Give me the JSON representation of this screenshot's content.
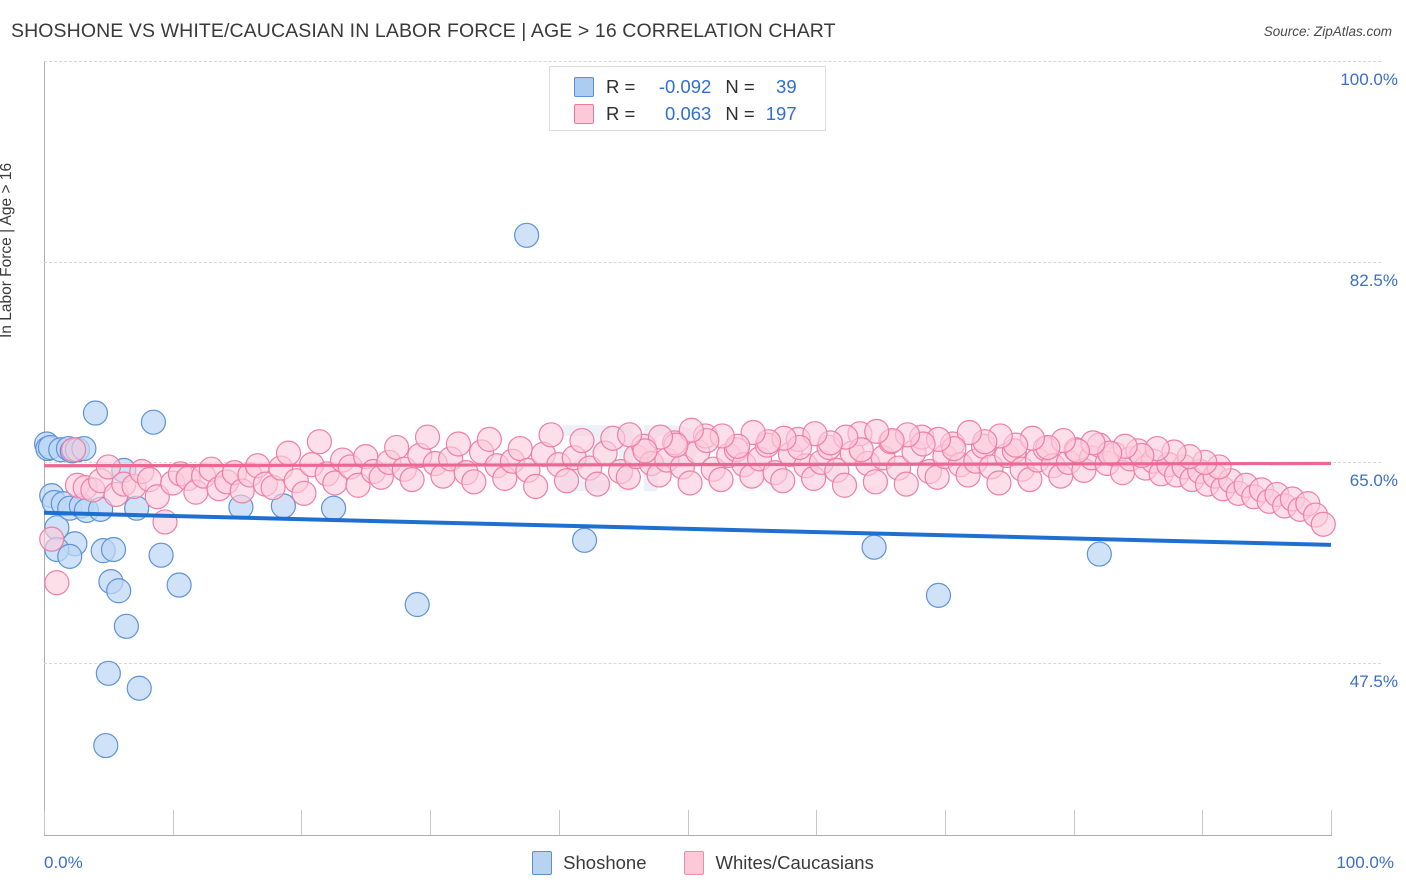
{
  "header": {
    "title": "SHOSHONE VS WHITE/CAUCASIAN IN LABOR FORCE | AGE > 16 CORRELATION CHART",
    "source": "Source: ZipAtlas.com"
  },
  "watermark": {
    "bold": "ZIP",
    "light": "atlas"
  },
  "axes": {
    "y_title": "In Labor Force | Age > 16",
    "y_ticks": [
      {
        "label": "100.0%",
        "value": 100.0
      },
      {
        "label": "82.5%",
        "value": 82.5
      },
      {
        "label": "65.0%",
        "value": 65.0
      },
      {
        "label": "47.5%",
        "value": 47.5
      }
    ],
    "x_min_label": "0.0%",
    "x_max_label": "100.0%"
  },
  "stats": {
    "rows": [
      {
        "swatch": "blue",
        "r_label": "R =",
        "r_value": "-0.092",
        "n_label": "N =",
        "n_value": "39"
      },
      {
        "swatch": "pink",
        "r_label": "R =",
        "r_value": "0.063",
        "n_label": "N =",
        "n_value": "197"
      }
    ]
  },
  "legend": {
    "items": [
      {
        "label": "Shoshone",
        "color": "#b8d3f2"
      },
      {
        "label": "Whites/Caucasians",
        "color": "#fcc9d9"
      }
    ]
  },
  "colors": {
    "blue_fill": "#bdd7f5",
    "blue_stroke": "#5f93d6",
    "pink_fill": "#fcccdc",
    "pink_stroke": "#ef7fa6",
    "blue_trend": "#1f6fd0",
    "pink_trend": "#ec6893",
    "label_blue": "#3b6fc4",
    "grid": "#d8d8d8"
  },
  "chart_data": {
    "type": "scatter",
    "title": "SHOSHONE VS WHITE/CAUCASIAN IN LABOR FORCE | AGE > 16 CORRELATION CHART",
    "xlabel": "",
    "ylabel": "In Labor Force | Age > 16",
    "xlim": [
      0,
      100
    ],
    "ylim": [
      32.5,
      100
    ],
    "grid": true,
    "legend_position": "bottom-center",
    "yticks": [
      47.5,
      65.0,
      82.5,
      100.0
    ],
    "series": [
      {
        "name": "Shoshone",
        "r": -0.092,
        "n": 39,
        "color": "#bdd7f5",
        "trend": {
          "x0": 0,
          "y0": 60.6,
          "x1": 100,
          "y1": 57.8
        },
        "points": [
          [
            0.2,
            66.6
          ],
          [
            0.3,
            66.2
          ],
          [
            0.5,
            66.3
          ],
          [
            0.6,
            62.1
          ],
          [
            0.8,
            61.5
          ],
          [
            1.3,
            66.1
          ],
          [
            1.9,
            66.2
          ],
          [
            2.2,
            66.0
          ],
          [
            2.6,
            66.1
          ],
          [
            3.1,
            66.2
          ],
          [
            4.0,
            69.3
          ],
          [
            1.0,
            59.3
          ],
          [
            1.5,
            61.4
          ],
          [
            2.0,
            61.0
          ],
          [
            2.9,
            61.2
          ],
          [
            3.3,
            60.8
          ],
          [
            4.4,
            60.9
          ],
          [
            2.4,
            57.9
          ],
          [
            1.0,
            57.4
          ],
          [
            2.0,
            56.8
          ],
          [
            4.6,
            57.3
          ],
          [
            5.4,
            57.4
          ],
          [
            6.2,
            64.3
          ],
          [
            7.2,
            61.0
          ],
          [
            8.5,
            68.5
          ],
          [
            9.1,
            56.9
          ],
          [
            10.5,
            54.3
          ],
          [
            5.2,
            54.6
          ],
          [
            5.8,
            53.8
          ],
          [
            6.4,
            50.7
          ],
          [
            5.0,
            46.6
          ],
          [
            7.4,
            45.3
          ],
          [
            4.8,
            40.3
          ],
          [
            15.3,
            61.1
          ],
          [
            18.6,
            61.2
          ],
          [
            22.5,
            61.0
          ],
          [
            29.0,
            52.6
          ],
          [
            37.5,
            84.8
          ],
          [
            42.0,
            58.2
          ],
          [
            64.5,
            57.6
          ],
          [
            69.5,
            53.4
          ],
          [
            82.0,
            57.0
          ]
        ]
      },
      {
        "name": "Whites/Caucasians",
        "r": 0.063,
        "n": 197,
        "color": "#fcccdc",
        "trend": {
          "x0": 0,
          "y0": 64.7,
          "x1": 100,
          "y1": 64.9
        },
        "points": [
          [
            0.6,
            58.3
          ],
          [
            1.0,
            54.5
          ],
          [
            2.3,
            66.1
          ],
          [
            2.6,
            63.0
          ],
          [
            3.2,
            62.8
          ],
          [
            3.8,
            62.6
          ],
          [
            4.4,
            63.4
          ],
          [
            5.0,
            64.6
          ],
          [
            5.6,
            62.2
          ],
          [
            6.2,
            63.1
          ],
          [
            7.0,
            62.9
          ],
          [
            7.6,
            64.2
          ],
          [
            8.2,
            63.5
          ],
          [
            8.8,
            62.0
          ],
          [
            9.4,
            59.8
          ],
          [
            10.0,
            63.2
          ],
          [
            10.6,
            64.0
          ],
          [
            11.2,
            63.6
          ],
          [
            11.8,
            62.4
          ],
          [
            12.4,
            63.8
          ],
          [
            13.0,
            64.4
          ],
          [
            13.6,
            62.7
          ],
          [
            14.2,
            63.3
          ],
          [
            14.8,
            64.1
          ],
          [
            15.4,
            62.5
          ],
          [
            16.0,
            63.9
          ],
          [
            16.6,
            64.7
          ],
          [
            17.2,
            63.1
          ],
          [
            17.8,
            62.8
          ],
          [
            18.4,
            64.5
          ],
          [
            19.0,
            65.8
          ],
          [
            19.6,
            63.4
          ],
          [
            20.2,
            62.3
          ],
          [
            20.8,
            64.8
          ],
          [
            21.4,
            66.8
          ],
          [
            22.0,
            64.0
          ],
          [
            22.6,
            63.2
          ],
          [
            23.2,
            65.2
          ],
          [
            23.8,
            64.6
          ],
          [
            24.4,
            63.0
          ],
          [
            25.0,
            65.5
          ],
          [
            25.6,
            64.2
          ],
          [
            26.2,
            63.7
          ],
          [
            26.8,
            65.0
          ],
          [
            27.4,
            66.3
          ],
          [
            28.0,
            64.4
          ],
          [
            28.6,
            63.5
          ],
          [
            29.2,
            65.6
          ],
          [
            29.8,
            67.2
          ],
          [
            30.4,
            64.9
          ],
          [
            31.0,
            63.8
          ],
          [
            31.6,
            65.3
          ],
          [
            32.2,
            66.6
          ],
          [
            32.8,
            64.1
          ],
          [
            33.4,
            63.3
          ],
          [
            34.0,
            65.9
          ],
          [
            34.6,
            67.0
          ],
          [
            35.2,
            64.7
          ],
          [
            35.8,
            63.6
          ],
          [
            36.4,
            65.1
          ],
          [
            37.0,
            66.2
          ],
          [
            37.6,
            64.3
          ],
          [
            38.2,
            62.9
          ],
          [
            38.8,
            65.7
          ],
          [
            39.4,
            67.4
          ],
          [
            40.0,
            64.8
          ],
          [
            40.6,
            63.4
          ],
          [
            41.2,
            65.4
          ],
          [
            41.8,
            66.9
          ],
          [
            42.4,
            64.5
          ],
          [
            43.0,
            63.1
          ],
          [
            43.6,
            65.8
          ],
          [
            44.2,
            67.1
          ],
          [
            44.8,
            64.2
          ],
          [
            45.4,
            63.7
          ],
          [
            46.0,
            65.5
          ],
          [
            46.6,
            66.4
          ],
          [
            47.2,
            64.9
          ],
          [
            47.8,
            63.9
          ],
          [
            48.4,
            65.2
          ],
          [
            49.0,
            66.7
          ],
          [
            49.6,
            64.6
          ],
          [
            50.2,
            63.2
          ],
          [
            50.8,
            65.9
          ],
          [
            51.4,
            67.3
          ],
          [
            52.0,
            64.4
          ],
          [
            52.6,
            63.5
          ],
          [
            53.2,
            65.6
          ],
          [
            53.8,
            66.1
          ],
          [
            54.4,
            64.8
          ],
          [
            55.0,
            63.8
          ],
          [
            55.6,
            65.3
          ],
          [
            56.2,
            66.5
          ],
          [
            56.8,
            64.1
          ],
          [
            57.4,
            63.4
          ],
          [
            58.0,
            65.7
          ],
          [
            58.6,
            67.0
          ],
          [
            59.2,
            64.7
          ],
          [
            59.8,
            63.6
          ],
          [
            60.4,
            65.0
          ],
          [
            61.0,
            66.3
          ],
          [
            61.6,
            64.3
          ],
          [
            62.2,
            63.0
          ],
          [
            62.8,
            65.8
          ],
          [
            63.4,
            67.5
          ],
          [
            64.0,
            64.9
          ],
          [
            64.6,
            63.3
          ],
          [
            65.2,
            65.4
          ],
          [
            65.8,
            66.8
          ],
          [
            66.4,
            64.5
          ],
          [
            67.0,
            63.1
          ],
          [
            67.6,
            65.9
          ],
          [
            68.2,
            67.2
          ],
          [
            68.8,
            64.2
          ],
          [
            69.4,
            63.7
          ],
          [
            70.0,
            65.5
          ],
          [
            70.6,
            66.6
          ],
          [
            71.2,
            64.8
          ],
          [
            71.8,
            63.9
          ],
          [
            72.4,
            65.1
          ],
          [
            73.0,
            66.4
          ],
          [
            73.6,
            64.6
          ],
          [
            74.2,
            63.2
          ],
          [
            74.8,
            65.6
          ],
          [
            75.4,
            66.0
          ],
          [
            76.0,
            64.4
          ],
          [
            76.6,
            63.5
          ],
          [
            77.2,
            65.2
          ],
          [
            77.8,
            66.2
          ],
          [
            78.4,
            64.7
          ],
          [
            79.0,
            63.8
          ],
          [
            79.6,
            65.0
          ],
          [
            80.2,
            66.1
          ],
          [
            80.8,
            64.3
          ],
          [
            81.4,
            65.4
          ],
          [
            82.0,
            66.5
          ],
          [
            82.6,
            64.9
          ],
          [
            83.2,
            65.7
          ],
          [
            83.8,
            64.1
          ],
          [
            84.4,
            65.3
          ],
          [
            85.0,
            66.0
          ],
          [
            85.6,
            64.5
          ],
          [
            86.2,
            65.1
          ],
          [
            86.8,
            64.0
          ],
          [
            87.4,
            64.8
          ],
          [
            88.0,
            63.9
          ],
          [
            88.6,
            64.6
          ],
          [
            89.2,
            63.5
          ],
          [
            89.8,
            64.2
          ],
          [
            90.4,
            63.1
          ],
          [
            91.0,
            63.8
          ],
          [
            91.6,
            62.7
          ],
          [
            92.2,
            63.4
          ],
          [
            92.8,
            62.3
          ],
          [
            93.4,
            63.0
          ],
          [
            94.0,
            62.0
          ],
          [
            94.6,
            62.6
          ],
          [
            95.2,
            61.6
          ],
          [
            95.8,
            62.2
          ],
          [
            96.4,
            61.2
          ],
          [
            97.0,
            61.8
          ],
          [
            97.6,
            60.9
          ],
          [
            98.2,
            61.4
          ],
          [
            98.8,
            60.4
          ],
          [
            99.4,
            59.6
          ],
          [
            91.3,
            64.6
          ],
          [
            90.2,
            65.0
          ],
          [
            89.0,
            65.5
          ],
          [
            87.8,
            65.9
          ],
          [
            86.5,
            66.2
          ],
          [
            85.3,
            65.6
          ],
          [
            84.0,
            66.4
          ],
          [
            82.8,
            65.8
          ],
          [
            81.5,
            66.7
          ],
          [
            80.3,
            66.0
          ],
          [
            79.2,
            66.9
          ],
          [
            78.0,
            66.3
          ],
          [
            76.8,
            67.1
          ],
          [
            75.5,
            66.5
          ],
          [
            74.3,
            67.3
          ],
          [
            73.1,
            66.8
          ],
          [
            71.9,
            67.6
          ],
          [
            70.7,
            66.2
          ],
          [
            69.5,
            67.0
          ],
          [
            68.3,
            66.6
          ],
          [
            67.1,
            67.4
          ],
          [
            65.9,
            66.9
          ],
          [
            64.7,
            67.7
          ],
          [
            63.5,
            66.1
          ],
          [
            62.3,
            67.2
          ],
          [
            61.1,
            66.7
          ],
          [
            59.9,
            67.5
          ],
          [
            58.7,
            66.3
          ],
          [
            57.5,
            67.1
          ],
          [
            56.3,
            66.8
          ],
          [
            55.1,
            67.6
          ],
          [
            53.9,
            66.4
          ],
          [
            52.7,
            67.3
          ],
          [
            51.5,
            66.9
          ],
          [
            50.3,
            67.8
          ],
          [
            49.1,
            66.5
          ],
          [
            47.9,
            67.2
          ],
          [
            46.7,
            66.0
          ],
          [
            45.5,
            67.4
          ]
        ]
      }
    ]
  }
}
